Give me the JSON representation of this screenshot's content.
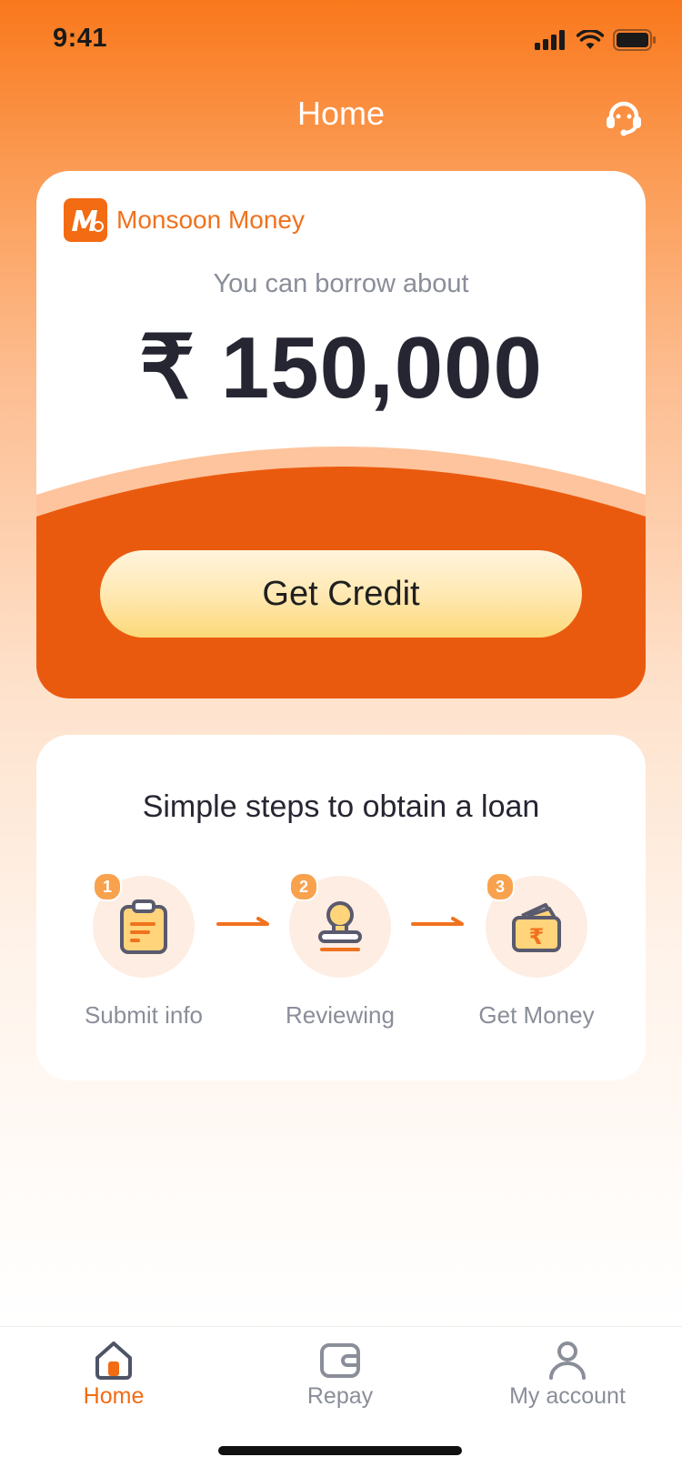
{
  "status_bar": {
    "time": "9:41"
  },
  "header": {
    "title": "Home",
    "support_icon": "headset-icon"
  },
  "loan_card": {
    "brand_name": "Monsoon Money",
    "borrow_label": "You can borrow about",
    "amount": "₹ 150,000",
    "cta_label": "Get Credit"
  },
  "steps": {
    "title": "Simple steps to obtain a loan",
    "items": [
      {
        "number": "1",
        "label": "Submit info",
        "icon": "clipboard-icon"
      },
      {
        "number": "2",
        "label": "Reviewing",
        "icon": "stamp-icon"
      },
      {
        "number": "3",
        "label": "Get Money",
        "icon": "wallet-icon"
      }
    ]
  },
  "tabbar": {
    "items": [
      {
        "label": "Home",
        "icon": "home-icon",
        "active": true
      },
      {
        "label": "Repay",
        "icon": "wallet-icon",
        "active": false
      },
      {
        "label": "My account",
        "icon": "person-icon",
        "active": false
      }
    ]
  },
  "colors": {
    "accent": "#F36B12",
    "card_band": "#EA5A0E",
    "button_gold": "#FFE7AE",
    "text_dark": "#262633",
    "text_muted": "#8A8E99"
  }
}
